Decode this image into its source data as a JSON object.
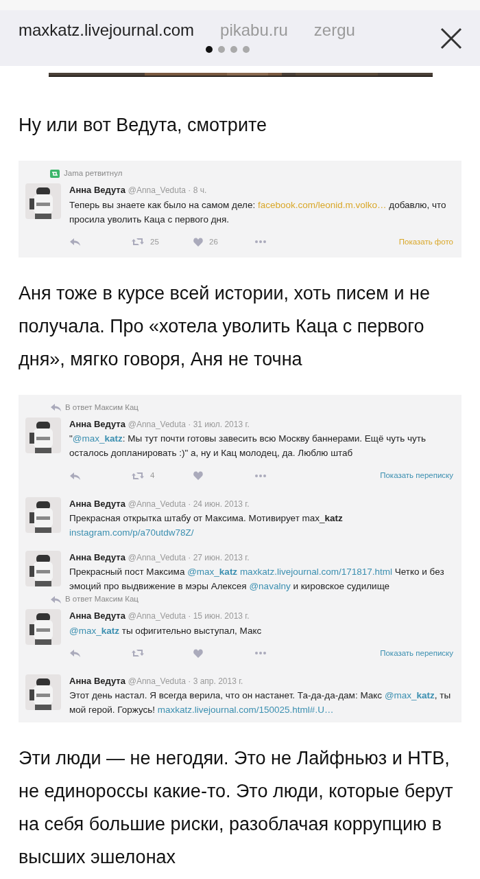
{
  "browser_bar": {
    "tabs": [
      {
        "label": "maxkatz.livejournal.com",
        "selected": true
      },
      {
        "label": "pikabu.ru",
        "selected": false
      },
      {
        "label": "zergu",
        "selected": false
      }
    ],
    "page_dots": [
      {
        "selected": true
      },
      {
        "selected": false
      },
      {
        "selected": false
      },
      {
        "selected": false
      }
    ]
  },
  "article": [
    {
      "kind": "picture"
    },
    {
      "kind": "paragraph",
      "text": "Ну или вот Ведута, смотрите"
    },
    {
      "kind": "tweets",
      "color": "#d9a728",
      "tweets": [
        {
          "context": {
            "kind": "retweet",
            "text": "Jama ретвитнул"
          },
          "author": "Анна Ведута",
          "handle": "@Anna_Veduta",
          "time": "· 8 ч.",
          "body": [
            {
              "text": "Теперь вы знаете как было на самом деле: ",
              "link": false
            },
            {
              "text": "facebook.com/leonid.m.volko…",
              "link": true
            },
            {
              "text": " добавлю, что просила уволить Каца с первого дня.",
              "link": false
            }
          ],
          "actions": {
            "retweets": "25",
            "likes": "26",
            "more": "Показать фото"
          }
        }
      ]
    },
    {
      "kind": "paragraph",
      "text": "Аня тоже в курсе всей истории, хоть писем и не получала. Про «хотела уволить Каца с первого дня», мягко говоря, Аня не точна"
    },
    {
      "kind": "tweets",
      "color": "#3b8fb0",
      "tweets": [
        {
          "context": {
            "kind": "reply",
            "text": "В ответ Максим Кац"
          },
          "author": "Анна Ведута",
          "handle": "@Anna_Veduta",
          "time": "· 31 июл. 2013 г.",
          "body": [
            {
              "text": "\"",
              "link": false
            },
            {
              "text": "@max_**katz**",
              "link": true
            },
            {
              "text": ": Мы тут почти готовы завесить всю Москву баннерами. Ещё чуть чуть осталось допланировать :)\" а, ну и Кац молодец, да. Люблю штаб",
              "link": false
            }
          ],
          "actions": {
            "retweets": "4",
            "more": "Показать переписку"
          }
        },
        {
          "author": "Анна Ведута",
          "handle": "@Anna_Veduta",
          "time": "· 24 июн. 2013 г.",
          "body": [
            {
              "text": "Прекрасная открытка штабу от Максима. Мотивирует max_**katz** ",
              "link": false
            },
            {
              "text": "instagram.com/p/a70utdw78Z/",
              "link": true
            }
          ]
        },
        {
          "author": "Анна Ведута",
          "handle": "@Anna_Veduta",
          "time": "· 27 июн. 2013 г.",
          "body": [
            {
              "text": "Прекрасный пост Максима ",
              "link": false
            },
            {
              "text": "@max_**katz** maxkatz.livejournal.com/171817.html",
              "link": true
            },
            {
              "text": " Четко и без эмоций про выдвижение в мэры Алексея ",
              "link": false
            },
            {
              "text": "@navalny",
              "link": true
            },
            {
              "text": " и кировское судилище",
              "link": false
            }
          ]
        },
        {
          "context": {
            "kind": "reply",
            "text": "В ответ Максим Кац"
          },
          "author": "Анна Ведута",
          "handle": "@Anna_Veduta",
          "time": "· 15 июн. 2013 г.",
          "body": [
            {
              "text": "@max_**katz**",
              "link": true
            },
            {
              "text": " ты офигительно выступал, Макс",
              "link": false
            }
          ],
          "actions": {
            "more": "Показать переписку"
          }
        },
        {
          "author": "Анна Ведута",
          "handle": "@Anna_Veduta",
          "time": "· 3 апр. 2013 г.",
          "body": [
            {
              "text": "Этот день настал. Я всегда верила, что он настанет. Та-да-да-дам: Макс ",
              "link": false
            },
            {
              "text": "@max_**katz**",
              "link": true
            },
            {
              "text": ", ты мой герой. Горжусь! ",
              "link": false
            },
            {
              "text": "maxkatz.livejournal.com/150025.html#.U…",
              "link": true
            }
          ]
        }
      ]
    },
    {
      "kind": "paragraph",
      "text": "Эти люди — не негодяи. Это не Лайфньюз и НТВ, не единороссы какие-то. Это люди, которые берут на себя большие риски, разоблачая коррупцию в высших эшелонах"
    }
  ]
}
